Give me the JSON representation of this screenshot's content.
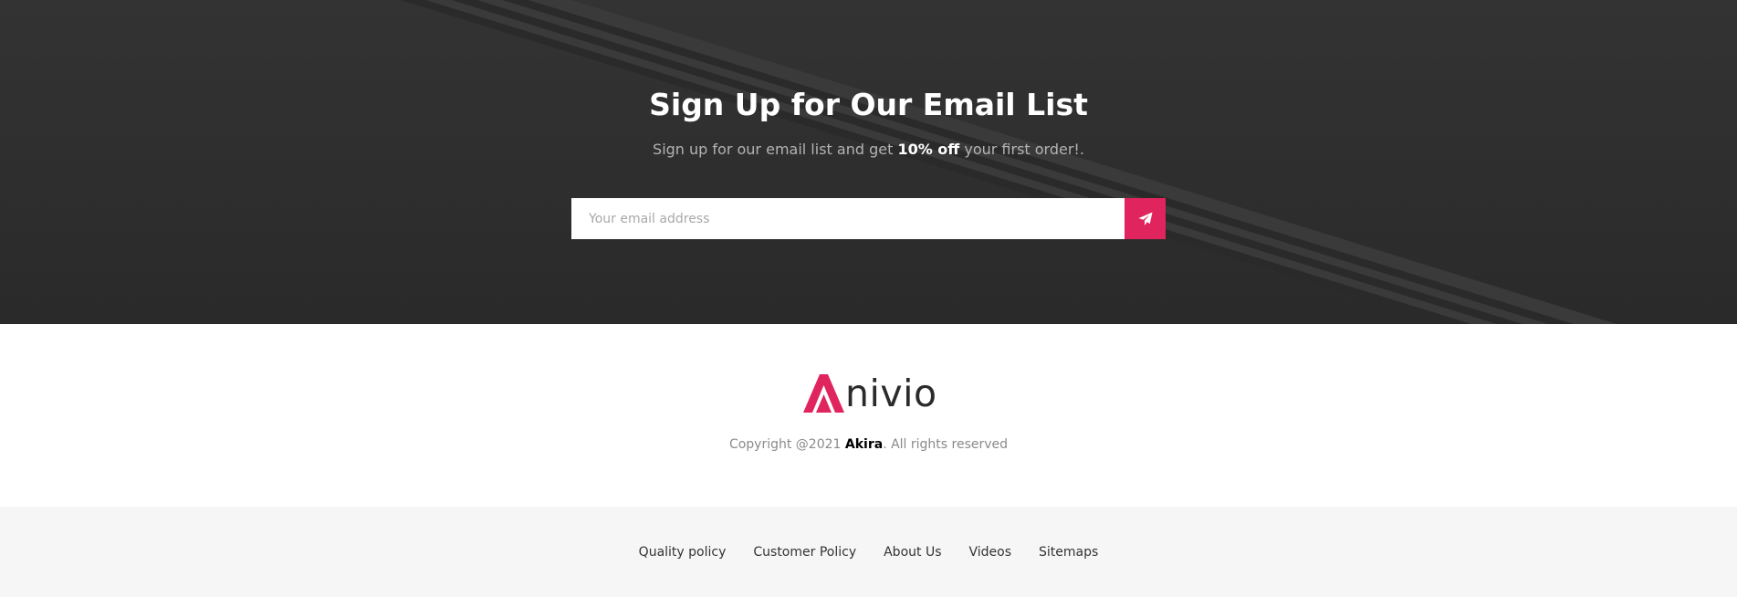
{
  "newsletter": {
    "title": "Sign Up for Our Email List",
    "subtitle_pre": "Sign up for our email list and get ",
    "subtitle_bold": "10% off",
    "subtitle_post": " your first order!.",
    "email_placeholder": "Your email address",
    "submit_icon": "paper-plane-icon",
    "accent_color": "#e0245e"
  },
  "footer": {
    "logo_text": "nivio",
    "logo_mark": "A",
    "copyright_pre": "Copyright @2021 ",
    "copyright_brand": "Akira",
    "copyright_post": ". All rights reserved"
  },
  "footer_links": [
    {
      "label": "Quality policy"
    },
    {
      "label": "Customer Policy"
    },
    {
      "label": "About Us"
    },
    {
      "label": "Videos"
    },
    {
      "label": "Sitemaps"
    }
  ]
}
